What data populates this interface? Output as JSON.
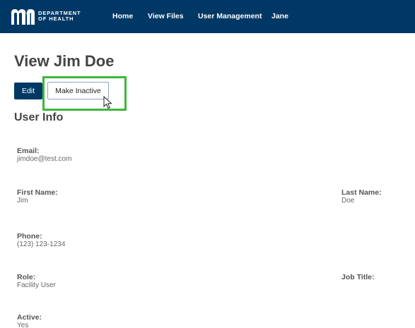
{
  "nav": {
    "logo_line1": "DEPARTMENT",
    "logo_line2": "OF HEALTH",
    "logo_mark": "mn-logo-icon",
    "links": [
      "Home",
      "View Files",
      "User Management",
      "Jane"
    ],
    "bar_color": "#003865"
  },
  "page": {
    "title": "View Jim Doe",
    "edit_label": "Edit",
    "make_inactive_label": "Make Inactive",
    "highlight_color": "#3cb83a",
    "section_title": "User Info"
  },
  "user_info": {
    "email_label": "Email:",
    "email_value": "jimdoe@test.com",
    "first_name_label": "First Name:",
    "first_name_value": "Jim",
    "last_name_label": "Last Name:",
    "last_name_value": "Doe",
    "phone_label": "Phone:",
    "phone_value": "(123) 123-1234",
    "role_label": "Role:",
    "role_value": "Facility User",
    "job_title_label": "Job Title:",
    "job_title_value": "",
    "active_label": "Active:",
    "active_value": "Yes"
  }
}
